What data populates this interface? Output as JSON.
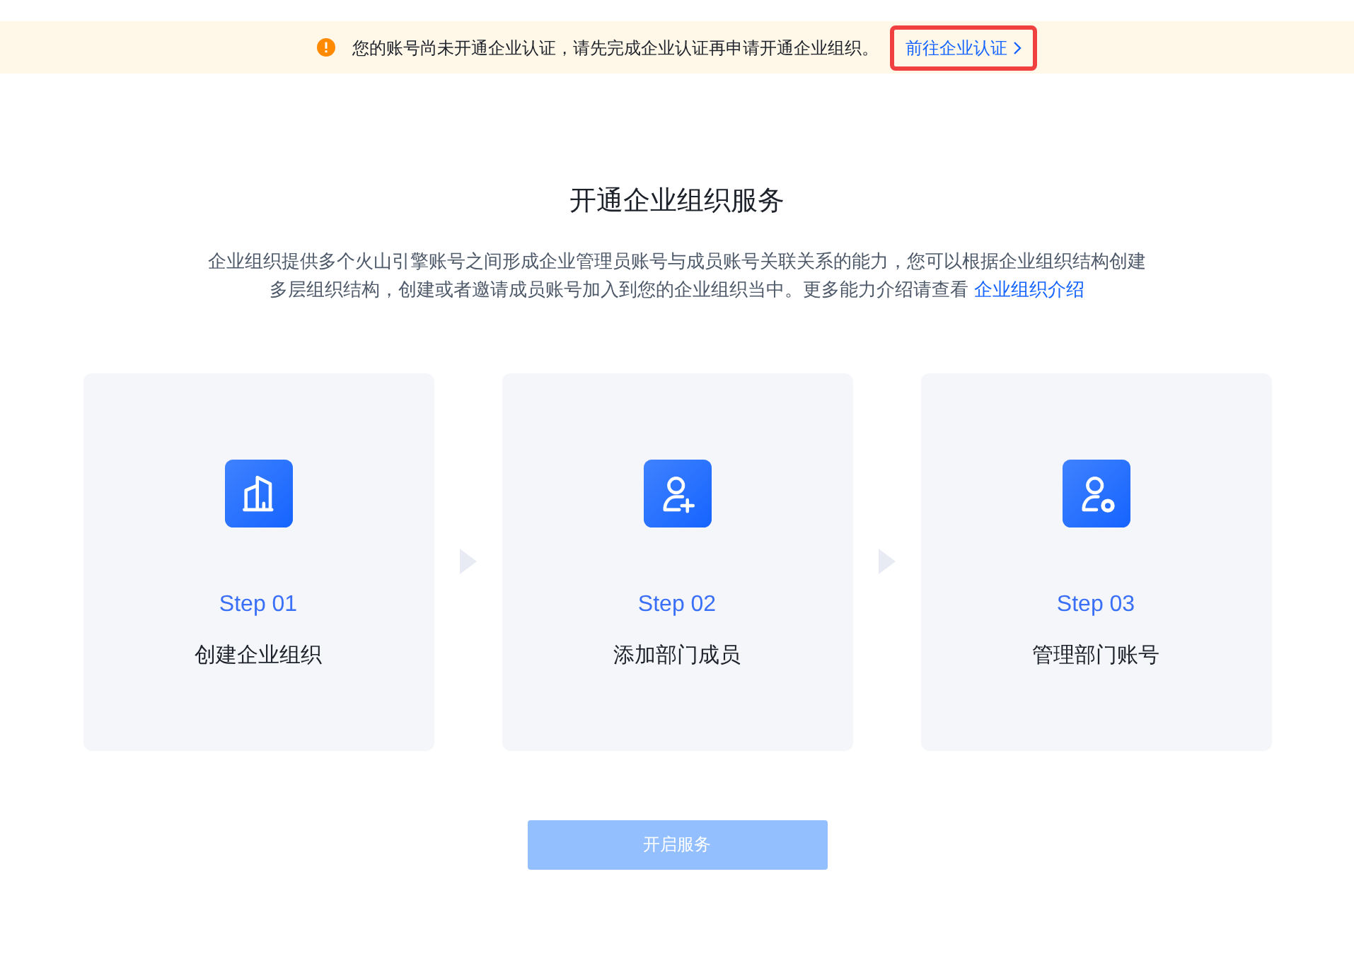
{
  "notice": {
    "text": "您的账号尚未开通企业认证，请先完成企业认证再申请开通企业组织。",
    "link": "前往企业认证",
    "highlighted": true
  },
  "title": "开通企业组织服务",
  "description": {
    "text": "企业组织提供多个火山引擎账号之间形成企业管理员账号与成员账号关联关系的能力，您可以根据企业组织结构创建多层组织结构，创建或者邀请成员账号加入到您的企业组织当中。更多能力介绍请查看 ",
    "link": "企业组织介绍"
  },
  "steps": [
    {
      "kind": "building",
      "step": "Step 01",
      "label": "创建企业组织"
    },
    {
      "kind": "add-user",
      "step": "Step 02",
      "label": "添加部门成员"
    },
    {
      "kind": "user-settings",
      "step": "Step 03",
      "label": "管理部门账号"
    }
  ],
  "button": {
    "label": "开启服务",
    "disabled": true
  }
}
